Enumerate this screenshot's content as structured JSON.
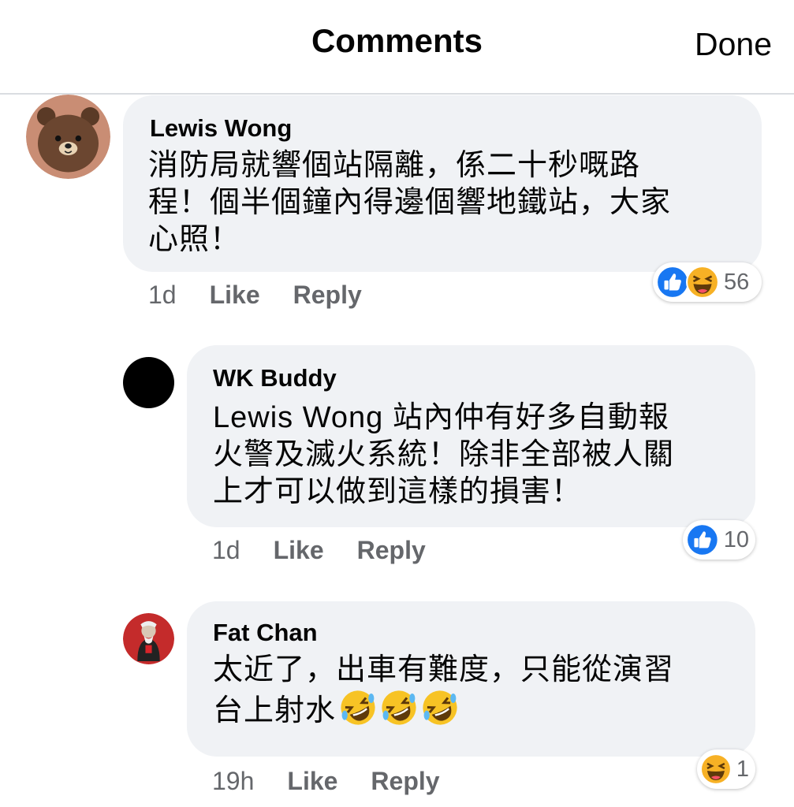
{
  "header": {
    "title": "Comments",
    "done_label": "Done"
  },
  "comments": [
    {
      "author": "Lewis Wong",
      "lines": [
        "消防局就響個站隔離，係二十秒嘅路",
        "程！個半個鐘內得邊個響地鐵站，大家",
        "心照！"
      ],
      "time": "1d",
      "like_label": "Like",
      "reply_label": "Reply",
      "reactions": [
        "like-icon",
        "haha-icon"
      ],
      "reaction_count": "56"
    },
    {
      "author": "WK Buddy",
      "lines": [
        "Lewis Wong 站內仲有好多自動報",
        "火警及滅火系統！除非全部被人關",
        "上才可以做到這樣的損害！"
      ],
      "time": "1d",
      "like_label": "Like",
      "reply_label": "Reply",
      "reactions": [
        "like-icon"
      ],
      "reaction_count": "10"
    },
    {
      "author": "Fat Chan",
      "lines": [
        "太近了，出車有難度，只能從演習",
        "台上射水"
      ],
      "trailing_emojis": [
        "rofl-emoji",
        "rofl-emoji",
        "rofl-emoji"
      ],
      "time": "19h",
      "like_label": "Like",
      "reply_label": "Reply",
      "reactions": [
        "haha-icon"
      ],
      "reaction_count": "1"
    }
  ],
  "colors": {
    "bubble": "#f0f2f5",
    "like_blue": "#1877f2",
    "meta_gray": "#65676b",
    "haha_yellow": "#f7b125"
  }
}
